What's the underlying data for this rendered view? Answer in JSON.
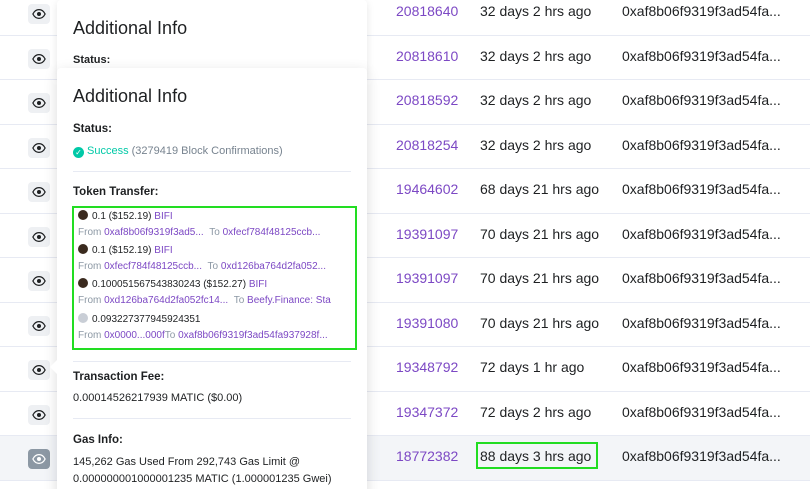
{
  "table": {
    "rows": [
      {
        "block": "20818640",
        "age": "32 days 2 hrs ago",
        "from": "0xaf8b06f9319f3ad54fa..."
      },
      {
        "block": "20818610",
        "age": "32 days 2 hrs ago",
        "from": "0xaf8b06f9319f3ad54fa..."
      },
      {
        "block": "20818592",
        "age": "32 days 2 hrs ago",
        "from": "0xaf8b06f9319f3ad54fa..."
      },
      {
        "block": "20818254",
        "age": "32 days 2 hrs ago",
        "from": "0xaf8b06f9319f3ad54fa..."
      },
      {
        "block": "19464602",
        "age": "68 days 21 hrs ago",
        "from": "0xaf8b06f9319f3ad54fa..."
      },
      {
        "block": "19391097",
        "age": "70 days 21 hrs ago",
        "from": "0xaf8b06f9319f3ad54fa..."
      },
      {
        "block": "19391097",
        "age": "70 days 21 hrs ago",
        "from": "0xaf8b06f9319f3ad54fa..."
      },
      {
        "block": "19391080",
        "age": "70 days 21 hrs ago",
        "from": "0xaf8b06f9319f3ad54fa..."
      },
      {
        "block": "19348792",
        "age": "72 days 1 hr ago",
        "from": "0xaf8b06f9319f3ad54fa..."
      },
      {
        "block": "19347372",
        "age": "72 days 2 hrs ago",
        "from": "0xaf8b06f9319f3ad54fa..."
      },
      {
        "block": "18772382",
        "age": "88 days 3 hrs ago",
        "from": "0xaf8b06f9319f3ad54fa..."
      }
    ]
  },
  "popover_back": {
    "title": "Additional Info",
    "status_label": "Status:"
  },
  "popover": {
    "title": "Additional Info",
    "status_label": "Status:",
    "status_value": "Success",
    "confirmations": "(3279419 Block Confirmations)",
    "token_transfer_label": "Token Transfer:",
    "transfers": [
      {
        "amount": "0.1 ($152.19)",
        "token": "BIFI",
        "from_label": "From",
        "from": "0xaf8b06f9319f3ad5...",
        "to_label": "To",
        "to": "0xfecf784f48125ccb..."
      },
      {
        "amount": "0.1 ($152.19)",
        "token": "BIFI",
        "from_label": "From",
        "from": "0xfecf784f48125ccb...",
        "to_label": "To",
        "to": "0xd126ba764d2fa052..."
      },
      {
        "amount": "0.100051567543830243 ($152.27)",
        "token": "BIFI",
        "from_label": "From",
        "from": "0xd126ba764d2fa052fc14...",
        "to_label": "To",
        "to": "Beefy.Finance: Sta"
      },
      {
        "amount": "0.093227377945924351",
        "token": "",
        "from_label": "From",
        "from": "0x0000...000f",
        "to_label": "To",
        "to": "0xaf8b06f9319f3ad54fa937928f..."
      }
    ],
    "fee_label": "Transaction Fee:",
    "fee_value": "0.00014526217939 MATIC ($0.00)",
    "gas_label": "Gas Info:",
    "gas_line1": "145,262 Gas Used From 292,743 Gas Limit @",
    "gas_line2": "0.000000001000001235 MATIC (1.000001235 Gwei)"
  },
  "colors": {
    "link_purple": "#7c48c4",
    "success_green": "#00c9a7",
    "highlight_box": "#22dd22"
  },
  "icons": {
    "eye": "eye-icon",
    "check": "check-circle-icon",
    "token": "token-icon"
  }
}
